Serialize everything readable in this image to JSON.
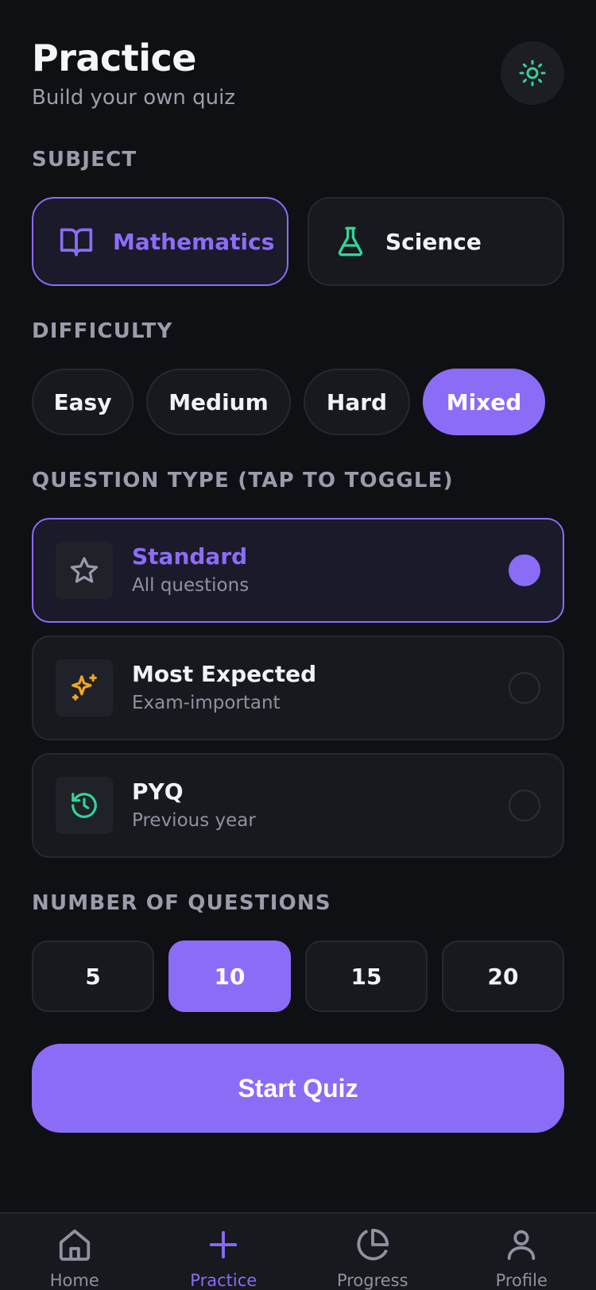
{
  "header": {
    "title": "Practice",
    "subtitle": "Build your own quiz",
    "theme_icon": "sun-icon"
  },
  "subject": {
    "label": "SUBJECT",
    "options": [
      {
        "label": "Mathematics",
        "icon": "book-open-icon",
        "selected": true
      },
      {
        "label": "Science",
        "icon": "flask-icon",
        "selected": false
      }
    ]
  },
  "difficulty": {
    "label": "DIFFICULTY",
    "options": [
      "Easy",
      "Medium",
      "Hard",
      "Mixed"
    ],
    "selected": "Mixed"
  },
  "question_type": {
    "label": "QUESTION TYPE (TAP TO TOGGLE)",
    "options": [
      {
        "title": "Standard",
        "subtitle": "All questions",
        "icon": "star-icon",
        "selected": true
      },
      {
        "title": "Most Expected",
        "subtitle": "Exam-important",
        "icon": "sparkles-icon",
        "selected": false
      },
      {
        "title": "PYQ",
        "subtitle": "Previous year",
        "icon": "history-icon",
        "selected": false
      }
    ]
  },
  "num_questions": {
    "label": "NUMBER OF QUESTIONS",
    "options": [
      "5",
      "10",
      "15",
      "20"
    ],
    "selected": "10"
  },
  "start_button": "Start Quiz",
  "nav": [
    {
      "label": "Home",
      "icon": "home-icon",
      "active": false
    },
    {
      "label": "Practice",
      "icon": "plus-icon",
      "active": true
    },
    {
      "label": "Progress",
      "icon": "pie-chart-icon",
      "active": false
    },
    {
      "label": "Profile",
      "icon": "user-icon",
      "active": false
    }
  ],
  "colors": {
    "accent": "#8b6cf6",
    "background": "#0f1014",
    "card": "#17191f",
    "green": "#34d399",
    "amber": "#f5a524"
  }
}
